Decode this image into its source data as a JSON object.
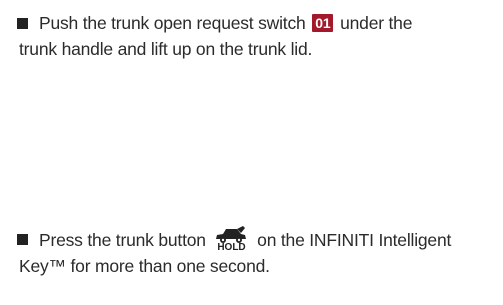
{
  "items": [
    {
      "bullet_icon": "square-bullet",
      "line1_before": "Push the trunk open request switch",
      "callout": "01",
      "line1_after": "under the",
      "line2": "trunk handle and lift up on the trunk lid."
    },
    {
      "bullet_icon": "square-bullet",
      "line1_before": "Press the trunk button",
      "icon_name": "car-trunk-open-icon",
      "icon_label": "HOLD",
      "line1_after": "on the INFINITI Intelligent",
      "line2": "Key™ for more than one second."
    }
  ],
  "colors": {
    "text": "#2b2b2b",
    "callout_bg": "#a3192b",
    "callout_text": "#ffffff"
  }
}
